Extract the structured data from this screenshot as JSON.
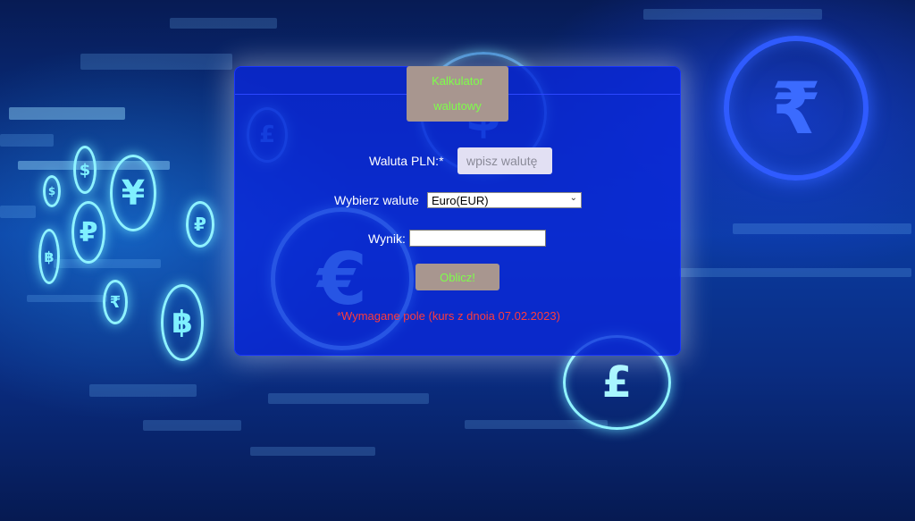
{
  "colors": {
    "panel": "#0a28dc",
    "button_bg": "#a8968f",
    "button_text": "#7dff4a",
    "error_text": "#ff3b3b",
    "input_bg": "#e2e0f3"
  },
  "background_symbols": [
    "€",
    "₹",
    "£",
    "¥",
    "₽",
    "฿",
    "₹",
    "$",
    "₽",
    "$",
    "฿",
    "¥",
    "£",
    "$"
  ],
  "form": {
    "title_line1": "Kalkulator",
    "title_line2": "walutowy",
    "pln_label": "Waluta PLN:*",
    "pln_placeholder": "wpisz walutę",
    "currency_label": "Wybierz walute",
    "currency_selected": "Euro(EUR)",
    "result_label": "Wynik:",
    "result_value": "",
    "calculate_label": "Oblicz!",
    "note": "*Wymagane pole (kurs z dnoia 07.02.2023)"
  },
  "icons": {
    "select_chevron": "chevron-down-icon"
  }
}
